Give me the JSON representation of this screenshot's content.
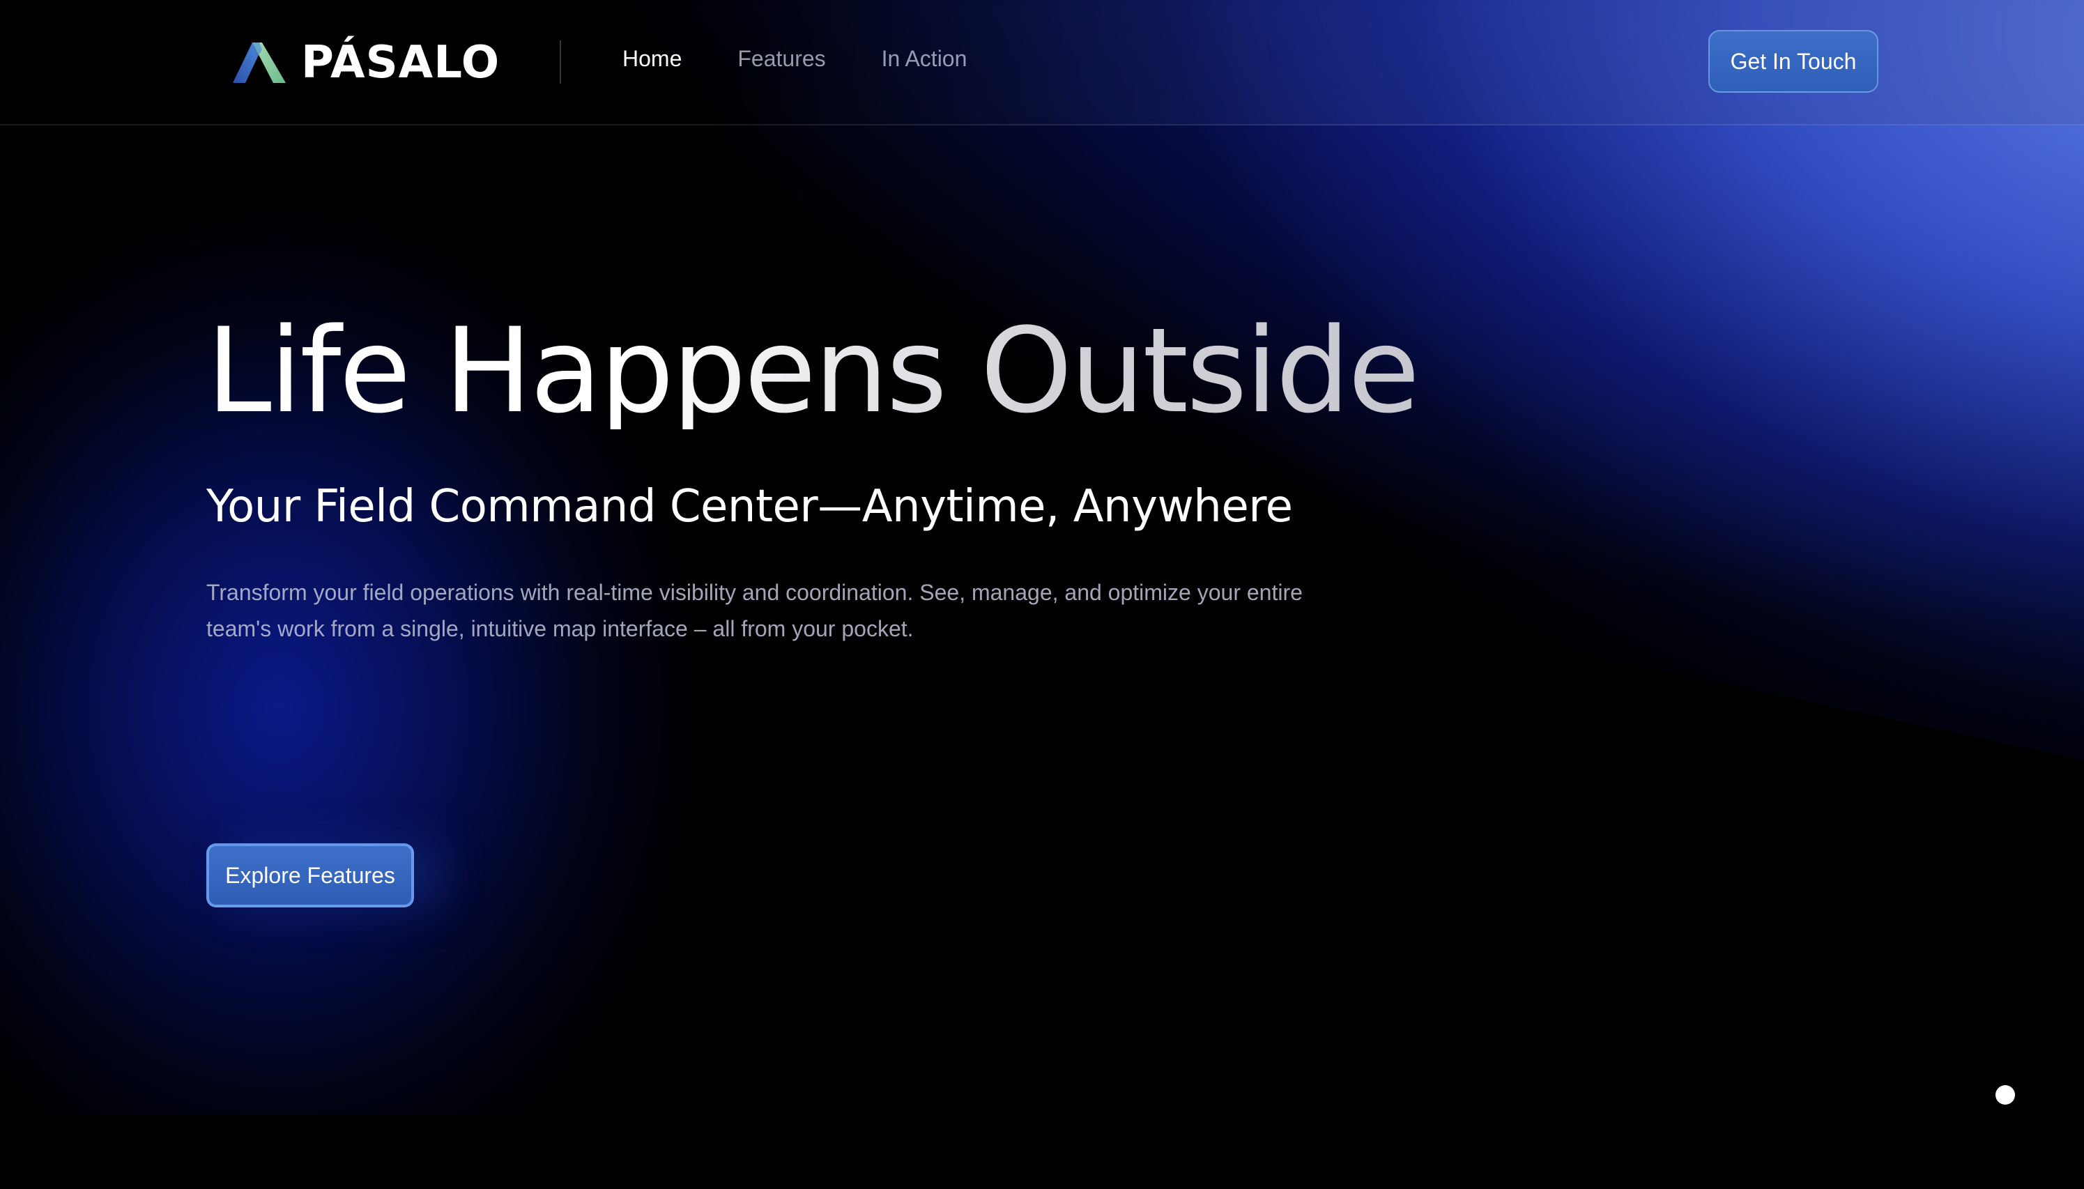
{
  "brand": {
    "name": "PÁSALO",
    "logo_icon": "mountain-logo-icon",
    "colors": {
      "logo_blue": "#2f5bb8",
      "logo_green": "#7fc79a",
      "accent": "#3566c0"
    }
  },
  "nav": {
    "items": [
      {
        "label": "Home",
        "active": true
      },
      {
        "label": "Features",
        "active": false
      },
      {
        "label": "In Action",
        "active": false
      }
    ],
    "cta_label": "Get In Touch"
  },
  "hero": {
    "title": "Life Happens Outside",
    "subtitle": "Your Field Command Center—Anytime, Anywhere",
    "description": "Transform your field operations with real-time visibility and coordination. See, manage, and optimize your entire team's work from a single, intuitive map interface – all from your pocket.",
    "cta_label": "Explore Features"
  }
}
